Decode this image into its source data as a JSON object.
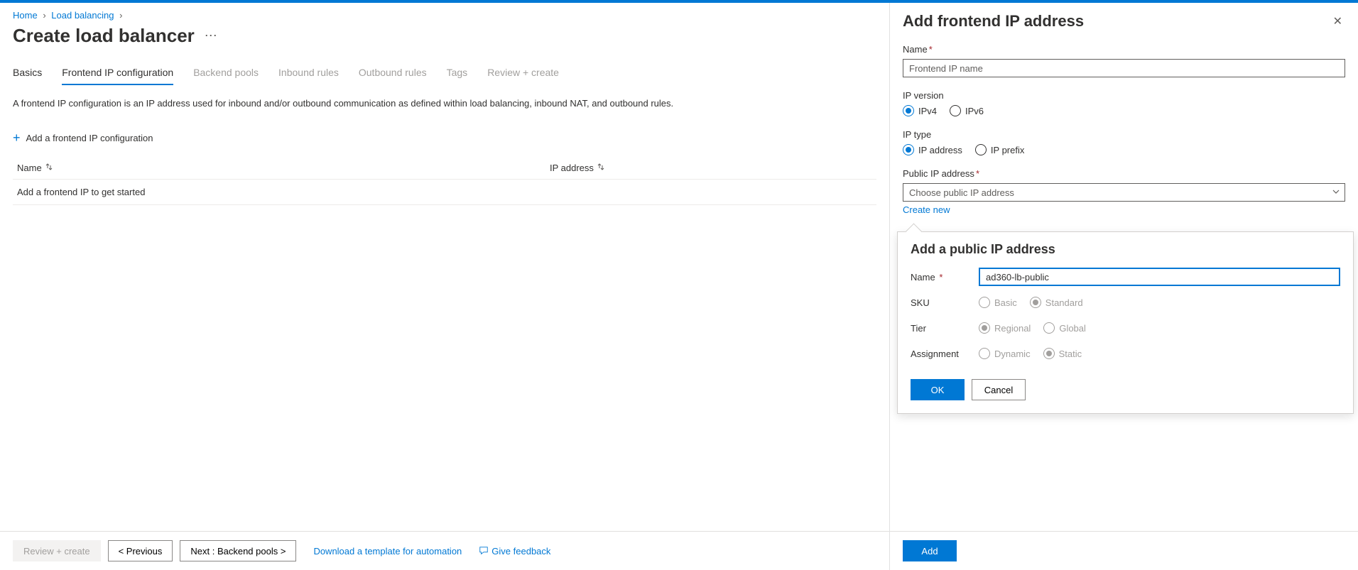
{
  "breadcrumb": {
    "home": "Home",
    "lb": "Load balancing"
  },
  "page": {
    "title": "Create load balancer"
  },
  "tabs": {
    "basics": "Basics",
    "frontend": "Frontend IP configuration",
    "backend": "Backend pools",
    "inbound": "Inbound rules",
    "outbound": "Outbound rules",
    "tags": "Tags",
    "review": "Review + create"
  },
  "desc": "A frontend IP configuration is an IP address used for inbound and/or outbound communication as defined within load balancing, inbound NAT, and outbound rules.",
  "add_config": "Add a frontend IP configuration",
  "table": {
    "col_name": "Name",
    "col_ip": "IP address",
    "empty": "Add a frontend IP to get started"
  },
  "bottombar": {
    "review": "Review + create",
    "prev": "< Previous",
    "next": "Next : Backend pools >",
    "download": "Download a template for automation",
    "feedback": "Give feedback"
  },
  "panel": {
    "title": "Add frontend IP address",
    "name_label": "Name",
    "name_placeholder": "Frontend IP name",
    "ipver_label": "IP version",
    "ipv4": "IPv4",
    "ipv6": "IPv6",
    "iptype_label": "IP type",
    "ipaddr": "IP address",
    "ipprefix": "IP prefix",
    "pubip_label": "Public IP address",
    "pubip_placeholder": "Choose public IP address",
    "create_new": "Create new",
    "add_btn": "Add"
  },
  "popup": {
    "title": "Add a public IP address",
    "name_label": "Name",
    "name_value": "ad360-lb-public",
    "sku_label": "SKU",
    "sku_basic": "Basic",
    "sku_standard": "Standard",
    "tier_label": "Tier",
    "tier_regional": "Regional",
    "tier_global": "Global",
    "assign_label": "Assignment",
    "assign_dynamic": "Dynamic",
    "assign_static": "Static",
    "ok": "OK",
    "cancel": "Cancel"
  }
}
